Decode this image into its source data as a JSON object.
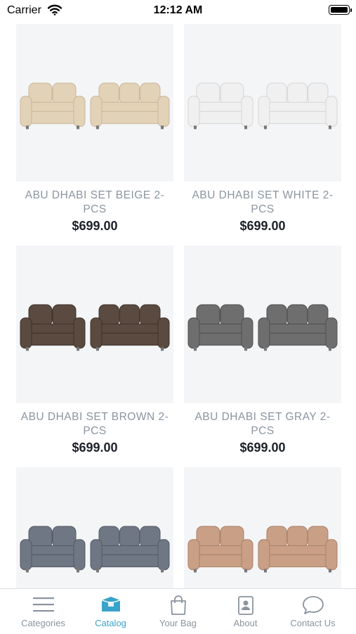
{
  "status_bar": {
    "carrier": "Carrier",
    "time": "12:12 AM"
  },
  "products": [
    {
      "name": "ABU DHABI SET BEIGE 2-PCS",
      "price": "$699.00",
      "color": "#e2d2b8",
      "shade": "#c9b697"
    },
    {
      "name": "ABU DHABI SET WHITE 2-PCS",
      "price": "$699.00",
      "color": "#f0f0f0",
      "shade": "#d6d6d6"
    },
    {
      "name": "ABU DHABI SET BROWN 2-PCS",
      "price": "$699.00",
      "color": "#5a4a40",
      "shade": "#3e322b"
    },
    {
      "name": "ABU DHABI SET GRAY 2-PCS",
      "price": "$699.00",
      "color": "#6e6e6e",
      "shade": "#4f4f4f"
    },
    {
      "name": "",
      "price": "",
      "color": "#6f7784",
      "shade": "#525965"
    },
    {
      "name": "",
      "price": "",
      "color": "#c9a086",
      "shade": "#a98068"
    }
  ],
  "tabs": [
    {
      "label": "Categories",
      "icon": "menu-icon",
      "active": false
    },
    {
      "label": "Catalog",
      "icon": "box-icon",
      "active": true
    },
    {
      "label": "Your Bag",
      "icon": "bag-icon",
      "active": false
    },
    {
      "label": "About",
      "icon": "contact-card-icon",
      "active": false
    },
    {
      "label": "Contact Us",
      "icon": "chat-bubble-icon",
      "active": false
    }
  ],
  "colors": {
    "accent": "#3aa3c9",
    "inactive": "#8a949f",
    "card_bg": "#f4f5f7"
  }
}
